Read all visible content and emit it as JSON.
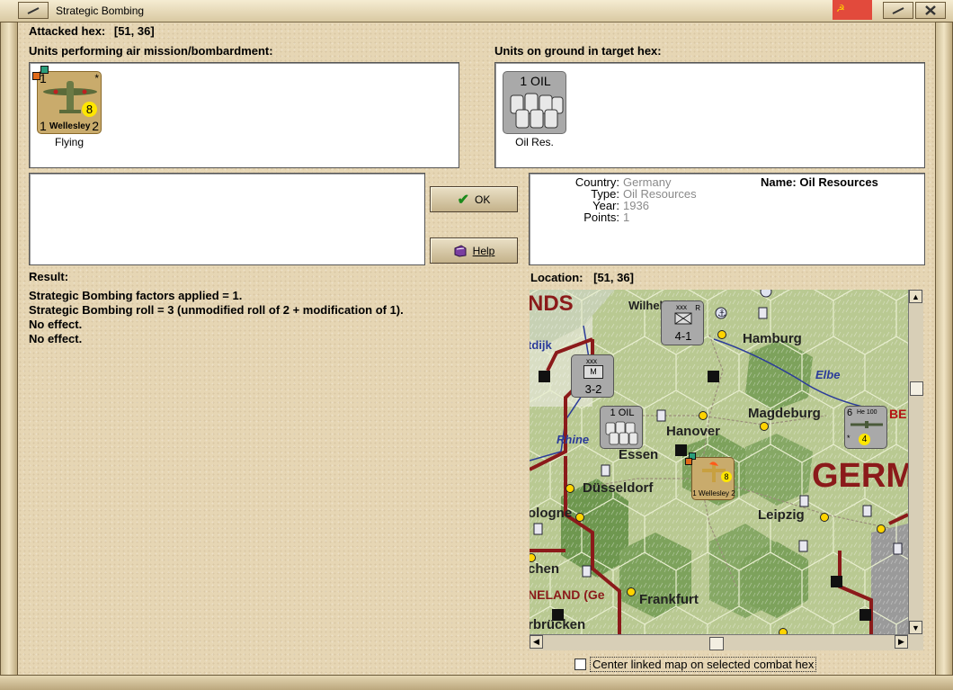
{
  "window": {
    "title": "Strategic Bombing"
  },
  "attacked_hex": {
    "label": "Attacked hex:",
    "value": "[51, 36]"
  },
  "air_panel": {
    "label": "Units performing air mission/bombardment:",
    "unit": {
      "top_left": "1",
      "factor": "8",
      "bottom_left": "1",
      "name": "Wellesley",
      "bottom_right": "2",
      "star": "*",
      "status": "Flying"
    }
  },
  "ground_panel": {
    "label": "Units on ground in target hex:",
    "unit": {
      "title": "1 OIL",
      "status": "Oil Res."
    }
  },
  "buttons": {
    "ok": "OK",
    "help": "Help"
  },
  "details": {
    "country_label": "Country:",
    "country": "Germany",
    "type_label": "Type:",
    "type": "Oil Resources",
    "year_label": "Year:",
    "year": "1936",
    "points_label": "Points:",
    "points": "1",
    "name_label": "Name:",
    "name": "Oil Resources"
  },
  "result": {
    "label": "Result:",
    "lines": [
      "Strategic Bombing factors applied = 1.",
      "Strategic Bombing roll = 3 (unmodified roll of 2 + modification of 1).",
      "No effect.",
      "No effect."
    ]
  },
  "location": {
    "label": "Location:",
    "value": "[51, 36]"
  },
  "map": {
    "labels": {
      "nds": "NDS",
      "wilhelm": "Wilhel",
      "hamburg": "Hamburg",
      "dijk": "tdijk",
      "elbe": "Elbe",
      "magdeburg": "Magdeburg",
      "be": "BE",
      "hanover": "Hanover",
      "rhine": "Rhine",
      "essen": "Essen",
      "germ": "GERM",
      "dusseldorf": "Düsseldorf",
      "cologne": "ologne",
      "leipzig": "Leipzig",
      "chen": "chen",
      "rheinland": "NELAND (Ge",
      "frankfurt": "Frankfurt",
      "bruecken": "rbrücken"
    },
    "units": {
      "corps1": {
        "size": "xxx",
        "factors": "4-1",
        "flag": "R"
      },
      "corps2": {
        "size": "xxx",
        "type": "M",
        "factors": "3-2"
      },
      "oil": {
        "title": "1 OIL"
      },
      "he100": {
        "range": "6",
        "name": "He 100",
        "factor": "4",
        "star": "*"
      },
      "wellesley": {
        "factor": "8",
        "name": "1 Wellesley 2"
      }
    }
  },
  "checkbox": {
    "label": "Center linked map on selected combat hex",
    "checked": false
  },
  "colors": {
    "parchment": "#e6d6b4",
    "unit_tan": "#c9ab6c",
    "unit_grey": "#a9a9a9",
    "map_border": "#8b1a1a"
  }
}
